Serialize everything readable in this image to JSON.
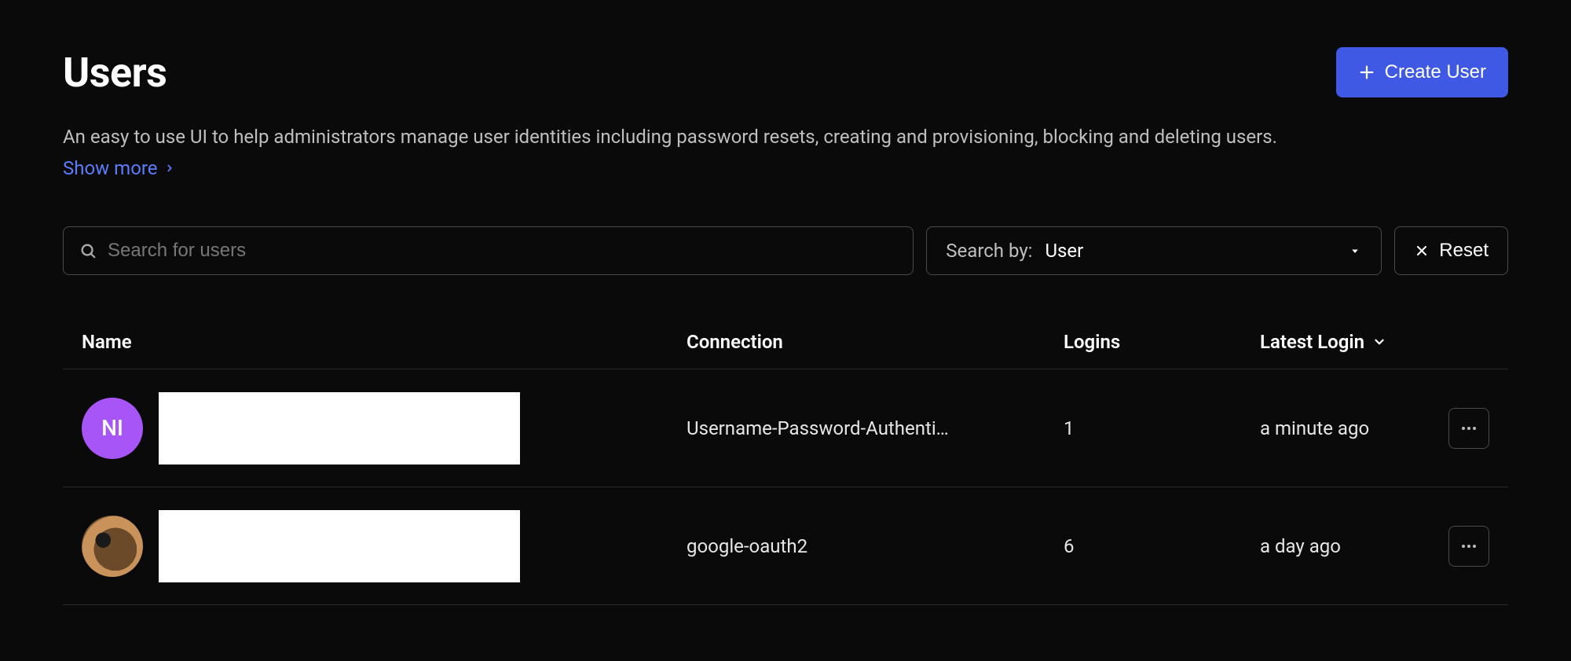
{
  "header": {
    "title": "Users",
    "create_label": "Create User"
  },
  "description": "An easy to use UI to help administrators manage user identities including password resets, creating and provisioning, blocking and deleting users.",
  "show_more_label": "Show more",
  "search": {
    "placeholder": "Search for users"
  },
  "search_by": {
    "label": "Search by:",
    "value": "User"
  },
  "reset_label": "Reset",
  "table": {
    "columns": {
      "name": "Name",
      "connection": "Connection",
      "logins": "Logins",
      "latest_login": "Latest Login"
    },
    "rows": [
      {
        "avatar_initials": "NI",
        "avatar_style": "ni",
        "connection": "Username-Password-Authenti…",
        "logins": "1",
        "latest_login": "a minute ago"
      },
      {
        "avatar_initials": "",
        "avatar_style": "guitar",
        "connection": "google-oauth2",
        "logins": "6",
        "latest_login": "a day ago"
      }
    ]
  }
}
